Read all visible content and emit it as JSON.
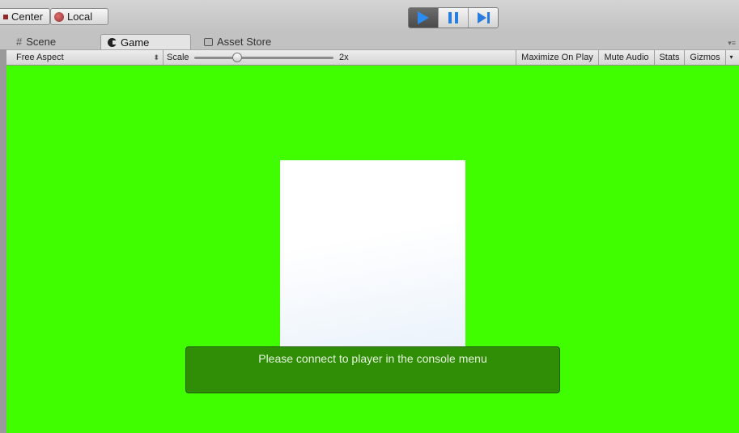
{
  "toolbar": {
    "pivot_mode_label": "Center",
    "pivot_rotation_label": "Local"
  },
  "playback": {
    "play_icon": "play-icon",
    "pause_icon": "pause-icon",
    "step_icon": "step-icon",
    "play_active": true
  },
  "tabs": [
    {
      "label": "Scene",
      "icon": "scene-grid-icon",
      "active": false
    },
    {
      "label": "Game",
      "icon": "game-icon",
      "active": true
    },
    {
      "label": "Asset Store",
      "icon": "asset-store-icon",
      "active": false
    }
  ],
  "game_toolbar": {
    "aspect_label": "Free Aspect",
    "scale_label": "Scale",
    "scale_value": "2x",
    "scale_slider_fraction": 0.31,
    "maximize_label": "Maximize On Play",
    "mute_label": "Mute Audio",
    "stats_label": "Stats",
    "gizmos_label": "Gizmos"
  },
  "viewport": {
    "background_color": "#40fe00",
    "notice_text": "Please connect to player in the console menu"
  }
}
